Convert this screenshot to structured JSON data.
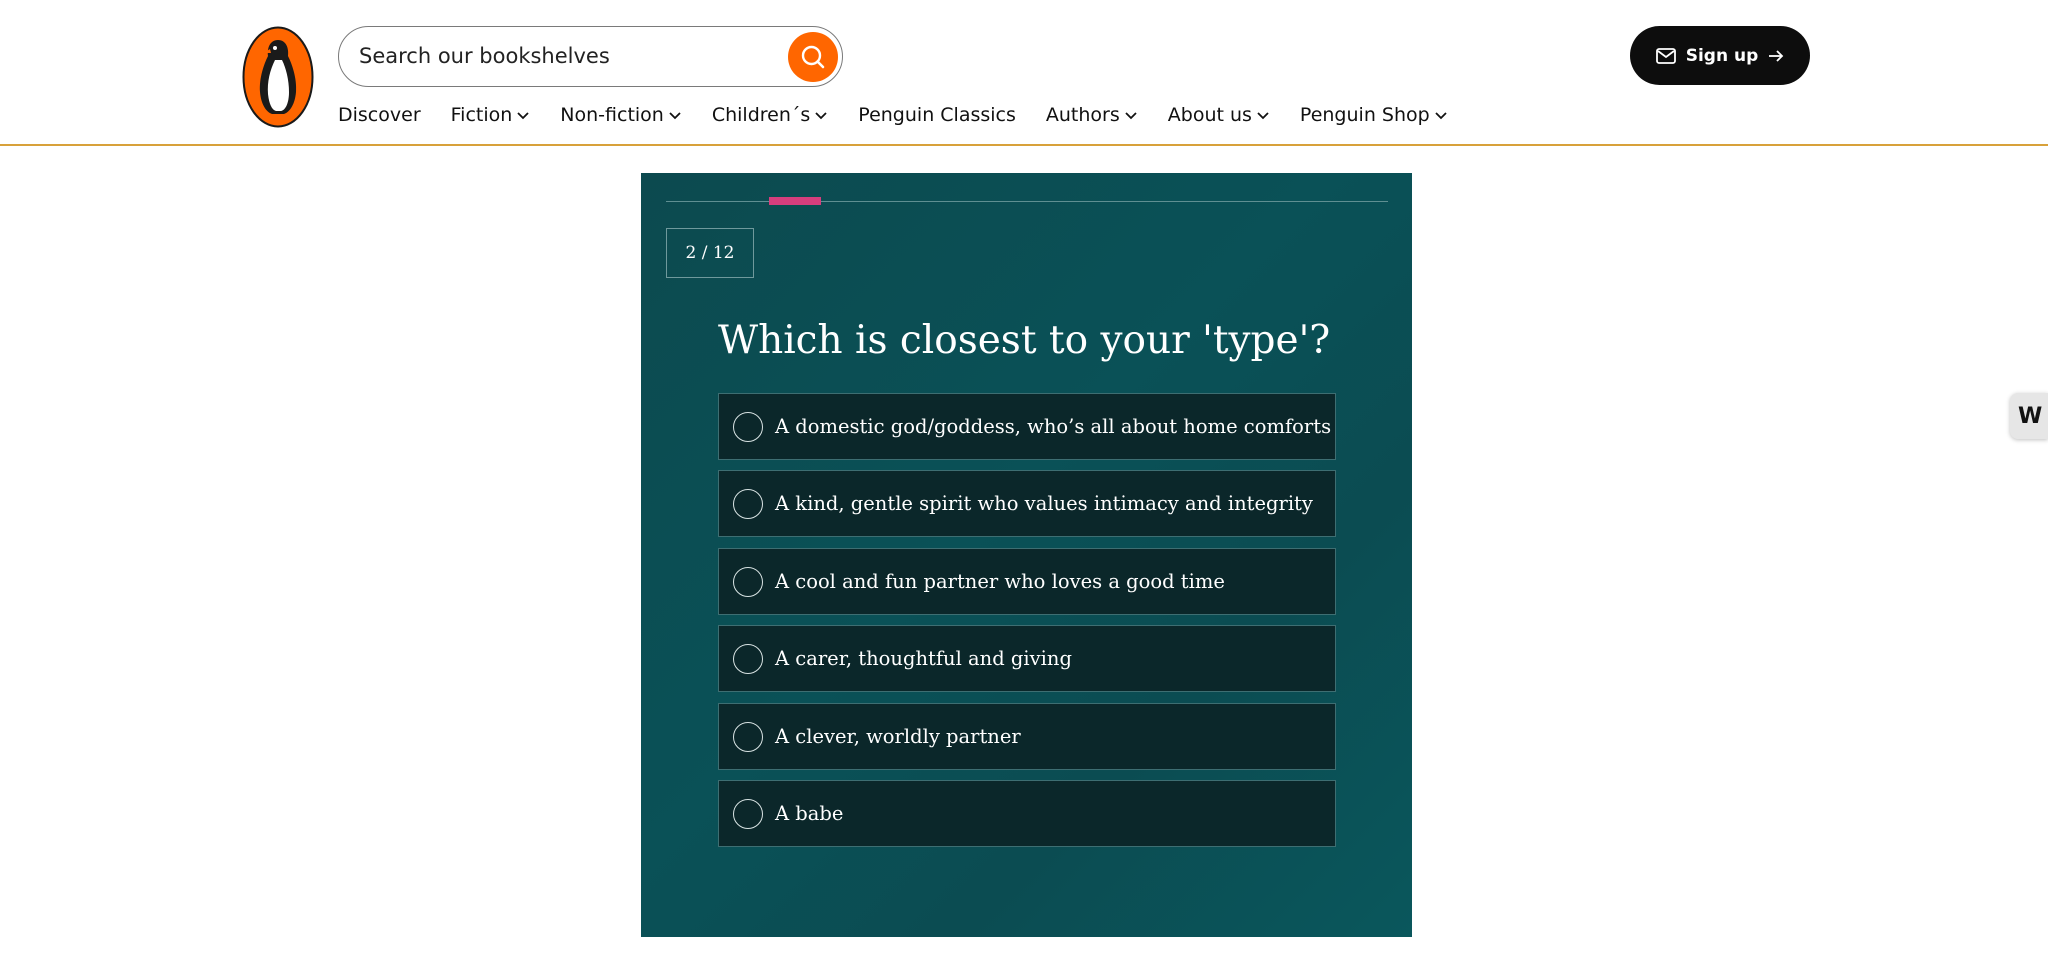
{
  "header": {
    "search": {
      "placeholder": "Search our bookshelves"
    },
    "signup_label": "Sign up",
    "nav": [
      {
        "label": "Discover",
        "dropdown": false
      },
      {
        "label": "Fiction",
        "dropdown": true
      },
      {
        "label": "Non-fiction",
        "dropdown": true
      },
      {
        "label": "Children´s",
        "dropdown": true
      },
      {
        "label": "Penguin Classics",
        "dropdown": false
      },
      {
        "label": "Authors",
        "dropdown": true
      },
      {
        "label": "About us",
        "dropdown": true
      },
      {
        "label": "Penguin Shop",
        "dropdown": true
      }
    ]
  },
  "quiz": {
    "counter": "2 / 12",
    "progress": {
      "current": 2,
      "total": 12
    },
    "question": "Which is closest to your 'type'?",
    "options": [
      "A domestic god/goddess, who’s all about home comforts",
      "A kind, gentle spirit who values intimacy and integrity",
      "A cool and fun partner who loves a good time",
      "A carer, thoughtful and giving",
      "A clever, worldly partner",
      "A babe"
    ]
  },
  "side_widget": {
    "label": "W"
  },
  "colors": {
    "brand_orange": "#ff6600",
    "header_rule": "#d8a13a",
    "quiz_bg": "#0a5157",
    "progress_accent": "#d63e7d",
    "option_bg": "#0b272a"
  }
}
